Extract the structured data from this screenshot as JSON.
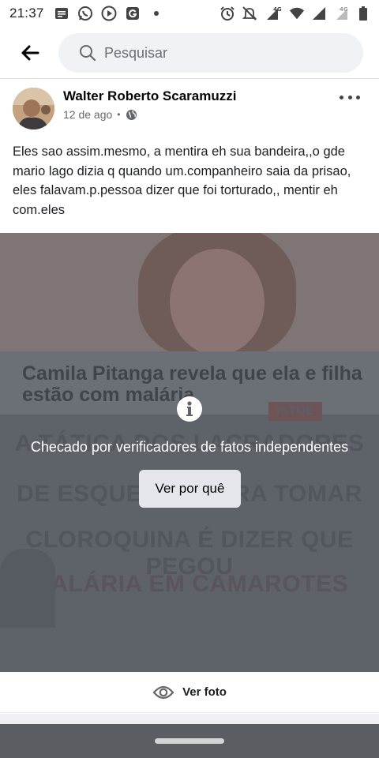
{
  "status_bar": {
    "time": "21:37",
    "network_left": "4G",
    "network_right": "4G"
  },
  "search": {
    "placeholder": "Pesquisar"
  },
  "post": {
    "author": "Walter Roberto Scaramuzzi",
    "time": "12 de ago",
    "separator": "•",
    "text": "Eles sao assim.mesmo, a mentira eh sua bandeira,,o gde mario lago dizia q quando um.companheiro saia da prisao, eles falavam.p.pessoa dizer que foi torturado,, mentir eh com.eles"
  },
  "image": {
    "headline": "Camila Pitanga revela que ela e filha estão com malária",
    "brand": "ISTOÉ",
    "bg_line_1": "A TÁTICA DOS LACRADORES",
    "bg_line_2": "DE ESQUERDA PARA TOMAR",
    "bg_line_3": "CLOROQUINA É DIZER QUE PEGOU",
    "bg_line_4": "MALÁRIA EM CAMAROTES"
  },
  "fact_check": {
    "message": "Checado por verificadores de fatos independentes",
    "button_label": "Ver por quê"
  },
  "see_photo": {
    "label": "Ver foto"
  },
  "colors": {
    "overlay": "#5d6369",
    "button_bg": "#e4e6eb",
    "search_bg": "#f0f2f5"
  }
}
